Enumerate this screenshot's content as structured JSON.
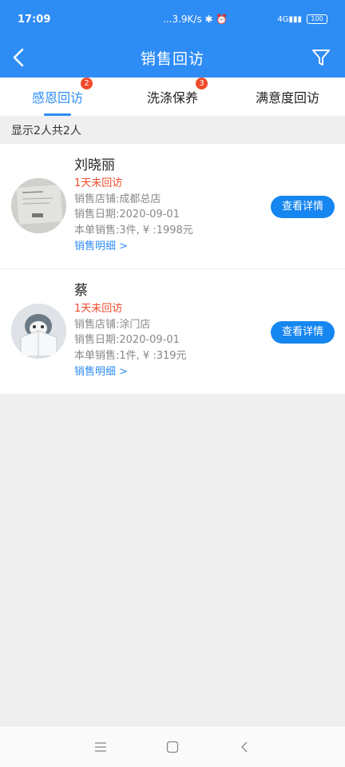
{
  "status_bar": {
    "time": "17:09",
    "network_speed": "...3.9K/s",
    "signal_text": "4G",
    "battery_level": "100"
  },
  "header": {
    "title": "销售回访",
    "back_icon": "chevron-left-icon",
    "filter_icon": "filter-icon"
  },
  "tabs": [
    {
      "label": "感恩回访",
      "badge": "2",
      "active": true
    },
    {
      "label": "洗涤保养",
      "badge": "3",
      "active": false
    },
    {
      "label": "满意度回访",
      "badge": "",
      "active": false
    }
  ],
  "summary": "显示2人共2人",
  "customers": [
    {
      "name": "刘晓丽",
      "status": "1天未回访",
      "store": "销售店铺:成都总店",
      "date": "销售日期:2020-09-01",
      "order": "本单销售:3件, ¥ :1998元",
      "detail_link": "销售明细 >",
      "button": "查看详情"
    },
    {
      "name": "蔡",
      "status": "1天未回访",
      "store": "销售店铺:涂门店",
      "date": "销售日期:2020-09-01",
      "order": "本单销售:1件, ¥ :319元",
      "detail_link": "销售明细 >",
      "button": "查看详情"
    }
  ],
  "colors": {
    "primary": "#2e8cf5",
    "button": "#1686f0",
    "alert": "#f04a2a"
  }
}
